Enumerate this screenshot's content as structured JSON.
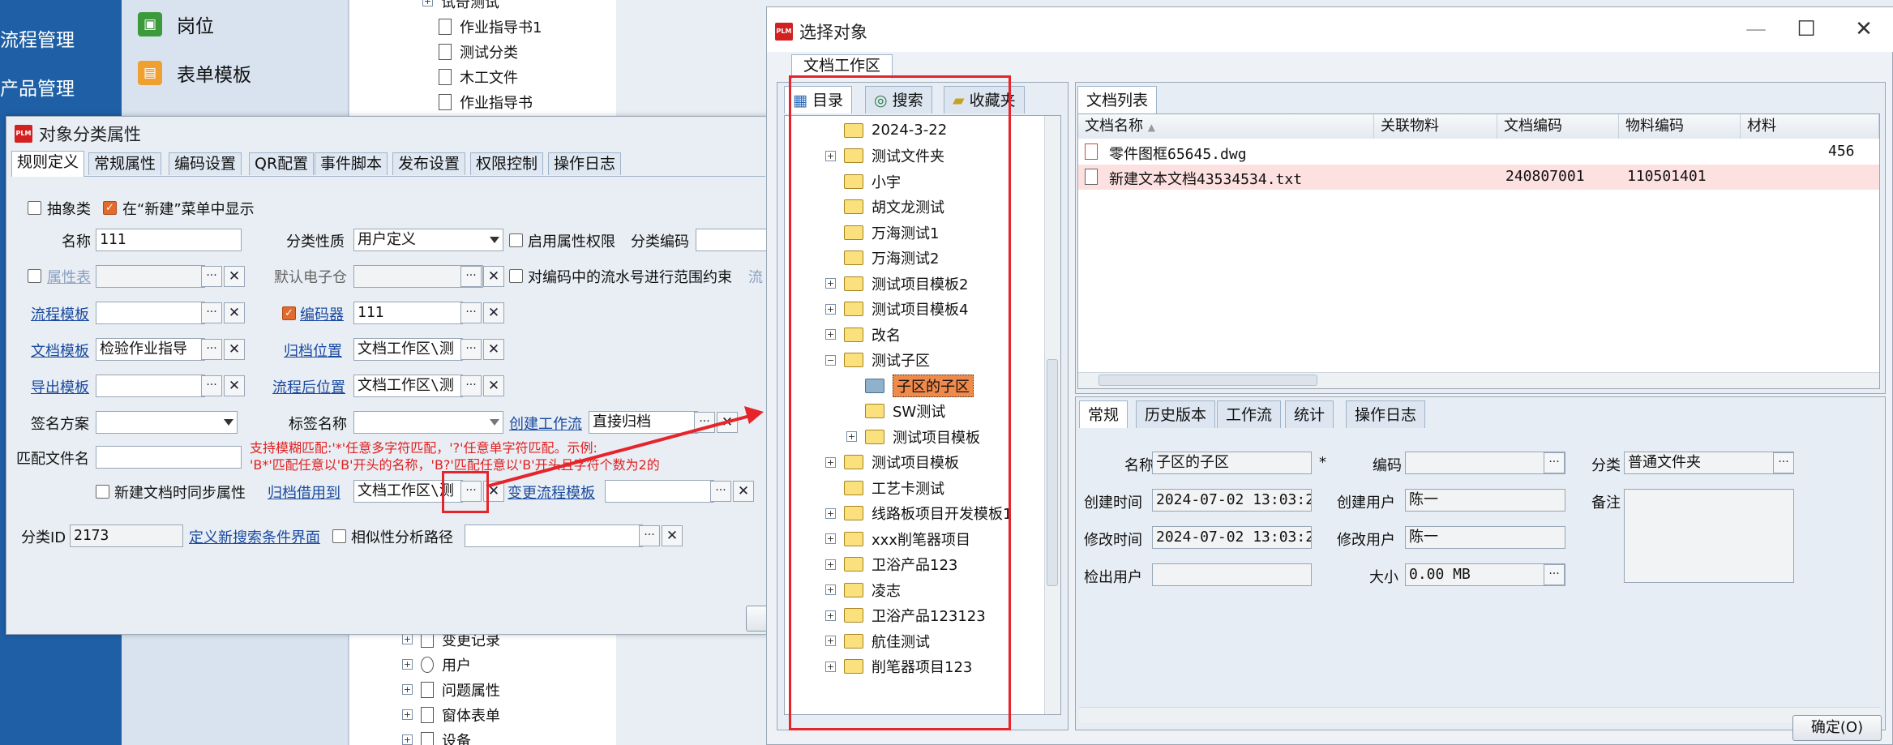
{
  "background": {
    "nav": [
      "流程管理",
      "产品管理"
    ],
    "mid_items": [
      {
        "label": "岗位",
        "icon": "position-icon",
        "color": "#3c9a3c"
      },
      {
        "label": "表单模板",
        "icon": "form-template-icon",
        "color": "#f0a030"
      }
    ],
    "tree_top": [
      "试奇测试",
      "作业指导书1",
      "测试分类",
      "木工文件",
      "作业指导书"
    ],
    "tree_bottom": [
      "变更记录",
      "用户",
      "问题属性",
      "窗体表单",
      "设备"
    ]
  },
  "dialog1": {
    "title": "对象分类属性",
    "tabs": [
      "规则定义",
      "常规属性",
      "编码设置",
      "QR配置",
      "事件脚本",
      "发布设置",
      "权限控制",
      "操作日志"
    ],
    "abstract_label": "抽象类",
    "new_menu_label": "在“新建”菜单中显示",
    "name_label": "名称",
    "name_value": "111",
    "class_nature_label": "分类性质",
    "class_nature_value": "用户定义",
    "enable_attr_perm_label": "启用属性权限",
    "class_code_label": "分类编码",
    "attr_table_label": "属性表",
    "default_ewh_label": "默认电子仓",
    "range_constraint_label": "对编码中的流水号进行范围约束",
    "range_constraint_suffix": "流",
    "flow_template_label": "流程模板",
    "encoder_label": "编码器",
    "encoder_value": "111",
    "doc_template_label": "文档模板",
    "doc_template_value": "检验作业指导",
    "archive_pos_label": "归档位置",
    "archive_pos_value": "文档工作区\\测",
    "export_template_label": "导出模板",
    "post_flow_pos_label": "流程后位置",
    "post_flow_pos_value": "文档工作区\\测",
    "sign_scheme_label": "签名方案",
    "tag_name_label": "标签名称",
    "create_workflow_label": "创建工作流",
    "create_workflow_value": "直接归档",
    "match_file_label": "匹配文件名",
    "hint_line1": "支持模糊匹配:'*'任意多字符匹配，'?'任意单字符匹配。示例:",
    "hint_line2": "'B*'匹配任意以'B'开头的名称，'B?'匹配任意以'B'开头且字符个数为2的",
    "sync_attr_label": "新建文档时同步属性",
    "archive_borrow_label": "归档借用到",
    "archive_borrow_value": "文档工作区\\测",
    "change_flow_label": "变更流程模板",
    "class_id_label": "分类ID",
    "class_id_value": "2173",
    "define_search_label": "定义新搜索条件界面",
    "similarity_label": "相似性分析路径"
  },
  "dialog2": {
    "title": "选择对象",
    "workspace_tab": "文档工作区",
    "left_tabs": [
      "目录",
      "搜索",
      "收藏夹"
    ],
    "tree": [
      {
        "label": "2024-3-22",
        "level": 0,
        "expander": "none"
      },
      {
        "label": "测试文件夹",
        "level": 0,
        "expander": "plus"
      },
      {
        "label": "小宇",
        "level": 0,
        "expander": "none"
      },
      {
        "label": "胡文龙测试",
        "level": 0,
        "expander": "none"
      },
      {
        "label": "万海测试1",
        "level": 0,
        "expander": "none"
      },
      {
        "label": "万海测试2",
        "level": 0,
        "expander": "none"
      },
      {
        "label": "测试项目模板2",
        "level": 0,
        "expander": "plus"
      },
      {
        "label": "测试项目模板4",
        "level": 0,
        "expander": "plus"
      },
      {
        "label": "改名",
        "level": 0,
        "expander": "plus"
      },
      {
        "label": "测试子区",
        "level": 0,
        "expander": "minus"
      },
      {
        "label": "子区的子区",
        "level": 1,
        "expander": "none",
        "selected": true
      },
      {
        "label": "SW测试",
        "level": 1,
        "expander": "none"
      },
      {
        "label": "测试项目模板",
        "level": 1,
        "expander": "plus"
      },
      {
        "label": "测试项目模板",
        "level": 0,
        "expander": "plus"
      },
      {
        "label": "工艺卡测试",
        "level": 0,
        "expander": "none"
      },
      {
        "label": "线路板项目开发模板1",
        "level": 0,
        "expander": "plus"
      },
      {
        "label": "xxx削笔器项目",
        "level": 0,
        "expander": "plus"
      },
      {
        "label": "卫浴产品123",
        "level": 0,
        "expander": "plus"
      },
      {
        "label": "凌志",
        "level": 0,
        "expander": "plus"
      },
      {
        "label": "卫浴产品123123",
        "level": 0,
        "expander": "plus"
      },
      {
        "label": "航佳测试",
        "level": 0,
        "expander": "plus"
      },
      {
        "label": "削笔器项目123",
        "level": 0,
        "expander": "plus"
      }
    ],
    "doclist_tab": "文档列表",
    "columns": [
      "文档名称",
      "关联物料",
      "文档编码",
      "物料编码",
      "材料"
    ],
    "rows": [
      {
        "name": "零件图框65645.dwg",
        "material": "",
        "code": "",
        "mat_code": "",
        "extra": "456",
        "highlight": false
      },
      {
        "name": "新建文本文档43534534.txt",
        "material": "",
        "code": "240807001",
        "mat_code": "110501401",
        "extra": "",
        "highlight": true
      }
    ],
    "detail_tabs": [
      "常规",
      "历史版本",
      "工作流",
      "统计",
      "操作日志"
    ],
    "detail": {
      "name_label": "名称",
      "name_value": "子区的子区",
      "required_mark": "*",
      "code_label": "编码",
      "class_label": "分类",
      "class_value": "普通文件夹",
      "ctime_label": "创建时间",
      "ctime_value": "2024-07-02 13:03:25",
      "cuser_label": "创建用户",
      "cuser_value": "陈一",
      "note_label": "备注",
      "mtime_label": "修改时间",
      "mtime_value": "2024-07-02 13:03:25",
      "muser_label": "修改用户",
      "muser_value": "陈一",
      "checkout_label": "检出用户",
      "size_label": "大小",
      "size_value": "0.00 MB"
    },
    "ok_button": "确定(O)"
  },
  "colors": {
    "annotation_red": "#e5242b",
    "selected_orange": "#f08a4b",
    "row_highlight": "#fde0e0"
  }
}
